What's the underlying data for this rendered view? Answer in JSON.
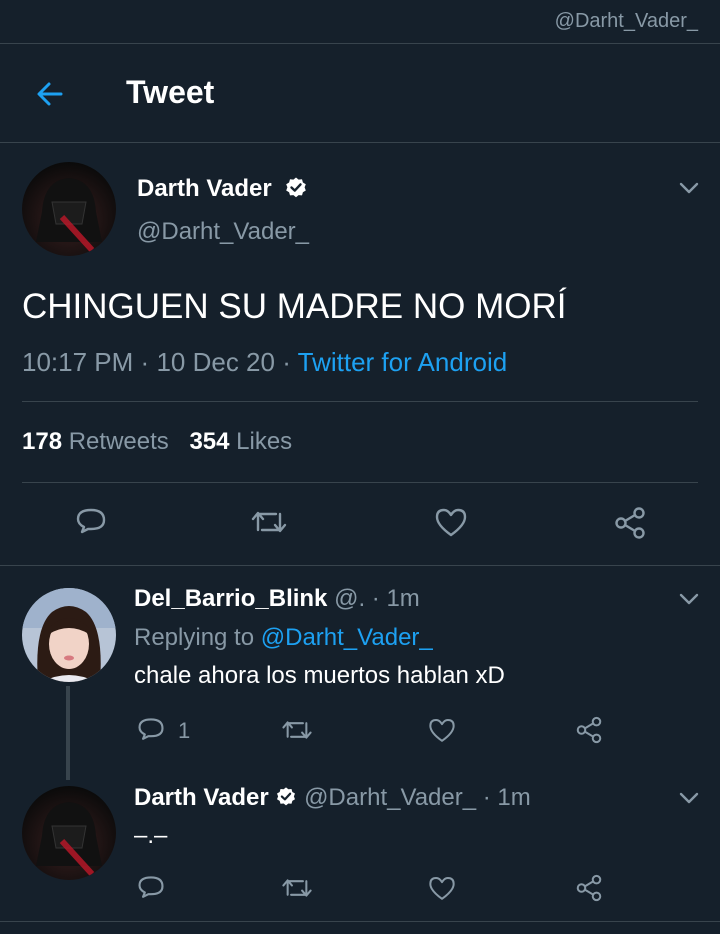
{
  "watermark": "@Darht_Vader_",
  "header": {
    "title": "Tweet",
    "back_icon": "arrow-left-icon"
  },
  "tweet": {
    "display_name": "Darth Vader",
    "handle": "@Darht_Vader_",
    "text": "CHINGUEN SU MADRE NO MORÍ",
    "time": "10:17 PM",
    "sep1": "·",
    "date": "10 Dec 20",
    "sep2": "·",
    "source": "Twitter for Android",
    "retweets_count": "178",
    "retweets_label": "Retweets",
    "likes_count": "354",
    "likes_label": "Likes"
  },
  "replies": [
    {
      "display_name": "Del_Barrio_Blink",
      "handle": "@.",
      "sep": "·",
      "time": "1m",
      "replying_prefix": "Replying to",
      "replying_to": "@Darht_Vader_",
      "text": "chale ahora los muertos hablan xD",
      "reply_count": "1"
    },
    {
      "display_name": "Darth Vader",
      "handle": "@Darht_Vader_",
      "sep": "·",
      "time": "1m",
      "text": "–.–"
    }
  ],
  "colors": {
    "background": "#15202b",
    "accent": "#1da1f2",
    "muted": "#8899a6",
    "divider": "#38444d"
  }
}
